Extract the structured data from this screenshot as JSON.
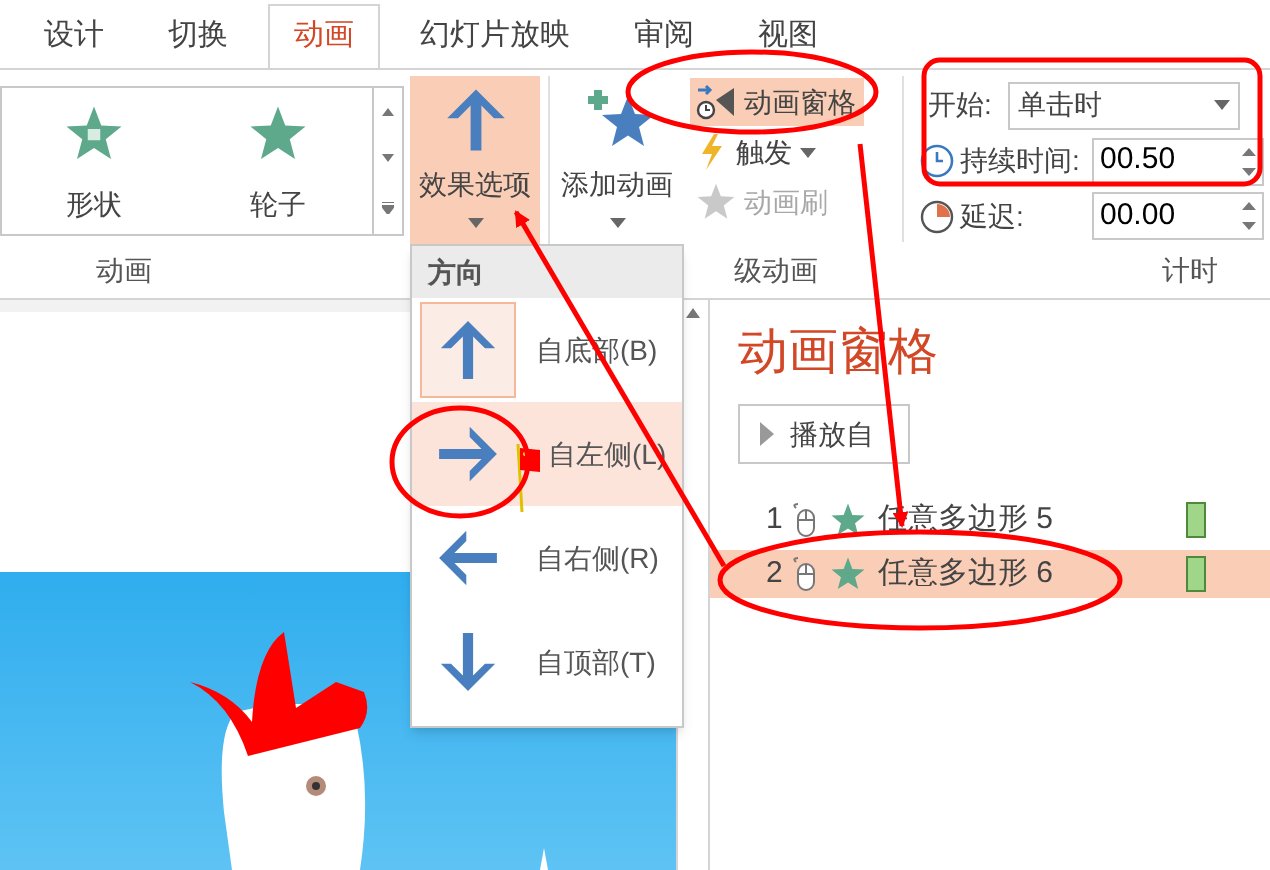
{
  "tabs": [
    {
      "label": "设计",
      "selected": false
    },
    {
      "label": "切换",
      "selected": false
    },
    {
      "label": "动画",
      "selected": true
    },
    {
      "label": "幻灯片放映",
      "selected": false
    },
    {
      "label": "审阅",
      "selected": false
    },
    {
      "label": "视图",
      "selected": false
    }
  ],
  "gallery": {
    "items": [
      {
        "label": "形状",
        "kind": "shape"
      },
      {
        "label": "轮子",
        "kind": "wheel"
      }
    ]
  },
  "effect_options": {
    "label": "效果选项",
    "pressed": true
  },
  "add_animation": {
    "label": "添加动画"
  },
  "advanced": [
    {
      "label": "动画窗格",
      "kind": "pane",
      "highlighted": true,
      "disabled": false
    },
    {
      "label": "触发",
      "kind": "trigger",
      "highlighted": false,
      "disabled": false
    },
    {
      "label": "动画刷",
      "kind": "painter",
      "highlighted": false,
      "disabled": true
    }
  ],
  "timing": {
    "start": {
      "label": "开始:",
      "value": "单击时"
    },
    "duration": {
      "label": "持续时间:",
      "value": "00.50"
    },
    "delay": {
      "label": "延迟:",
      "value": "00.00"
    }
  },
  "group_labels": [
    "动画",
    "级动画",
    "计时"
  ],
  "direction_menu": {
    "header": "方向",
    "items": [
      {
        "label": "自底部(B)",
        "kind": "up",
        "selected": true,
        "highlighted": false
      },
      {
        "label": "自左侧(L)",
        "kind": "right",
        "selected": false,
        "highlighted": true
      },
      {
        "label": "自右侧(R)",
        "kind": "left",
        "selected": false,
        "highlighted": false
      },
      {
        "label": "自顶部(T)",
        "kind": "down",
        "selected": false,
        "highlighted": false
      }
    ]
  },
  "animation_pane": {
    "title": "动画窗格",
    "play_button": "播放自",
    "items": [
      {
        "number": "1",
        "name": "任意多边形 5",
        "selected": false
      },
      {
        "number": "2",
        "name": "任意多边形 6",
        "selected": true
      }
    ]
  }
}
